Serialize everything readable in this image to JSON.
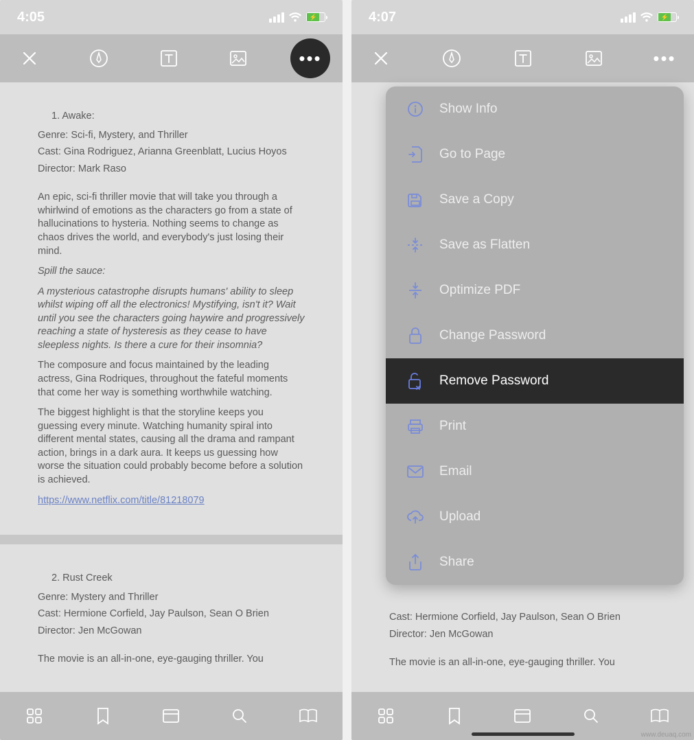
{
  "left": {
    "status": {
      "time": "4:05"
    },
    "doc": {
      "items": [
        {
          "num": "1. Awake:",
          "genre": "Genre: Sci-fi, Mystery, and Thriller",
          "cast": "Cast: Gina Rodriguez, Arianna Greenblatt, Lucius Hoyos",
          "director": "Director: Mark Raso",
          "p1": "An epic, sci-fi thriller movie that will take you through a whirlwind of emotions as the characters go from a state of hallucinations to hysteria. Nothing seems to change as chaos drives the world, and everybody's just losing their mind.",
          "spill": "Spill the sauce:",
          "p2": "A mysterious catastrophe disrupts humans' ability to sleep whilst wiping off all the electronics! Mystifying, isn't it? Wait until you see the characters going haywire and progressively reaching a state of hysteresis as they cease to have sleepless nights. Is there a cure for their insomnia?",
          "p3": "The composure and focus maintained by the leading actress, Gina Rodriques, throughout the fateful moments that come her way is something worthwhile watching.",
          "p4": "The biggest highlight is that the storyline keeps you guessing every minute. Watching humanity spiral into different mental states, causing all the drama and rampant action, brings in a dark aura. It keeps us guessing how worse the situation could probably become before a solution is achieved.",
          "link": "https://www.netflix.com/title/81218079"
        },
        {
          "num": "2. Rust Creek",
          "genre": "Genre: Mystery and Thriller",
          "cast": "Cast: Hermione Corfield, Jay Paulson, Sean O Brien",
          "director": "Director: Jen McGowan",
          "p1": "The movie is an all-in-one, eye-gauging thriller. You"
        }
      ]
    }
  },
  "right": {
    "status": {
      "time": "4:07"
    },
    "menu": {
      "items": [
        {
          "label": "Show Info",
          "icon": "info-icon"
        },
        {
          "label": "Go to Page",
          "icon": "goto-page-icon"
        },
        {
          "label": "Save a Copy",
          "icon": "save-copy-icon"
        },
        {
          "label": "Save as Flatten",
          "icon": "flatten-icon"
        },
        {
          "label": "Optimize PDF",
          "icon": "optimize-icon"
        },
        {
          "label": "Change Password",
          "icon": "lock-icon"
        },
        {
          "label": "Remove Password",
          "icon": "unlock-remove-icon",
          "selected": true
        },
        {
          "label": "Print",
          "icon": "print-icon"
        },
        {
          "label": "Email",
          "icon": "email-icon"
        },
        {
          "label": "Upload",
          "icon": "upload-icon"
        },
        {
          "label": "Share",
          "icon": "share-icon"
        }
      ]
    },
    "doc": {
      "cast": "Cast: Hermione Corfield, Jay Paulson, Sean O Brien",
      "director": "Director: Jen McGowan",
      "p1": "The movie is an all-in-one, eye-gauging thriller. You"
    }
  },
  "watermark": "www.deuaq.com"
}
